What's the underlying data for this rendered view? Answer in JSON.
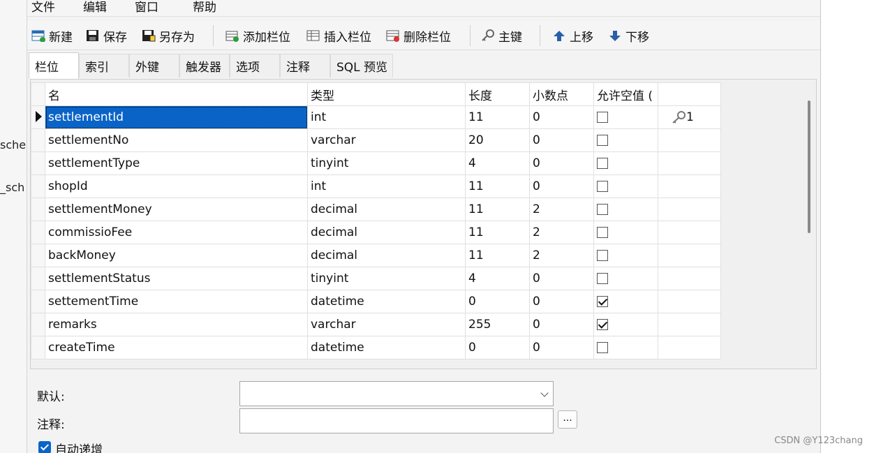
{
  "background_fragments": [
    "sche",
    "_sch"
  ],
  "menu": [
    "文件",
    "编辑",
    "窗口",
    "帮助"
  ],
  "toolbar": {
    "new": "新建",
    "save": "保存",
    "save_as": "另存为",
    "add_field": "添加栏位",
    "insert_field": "插入栏位",
    "delete_field": "删除栏位",
    "primary_key": "主键",
    "move_up": "上移",
    "move_down": "下移"
  },
  "tabs": [
    "栏位",
    "索引",
    "外键",
    "触发器",
    "选项",
    "注释",
    "SQL 预览"
  ],
  "active_tab": "栏位",
  "grid": {
    "headers": [
      "名",
      "类型",
      "长度",
      "小数点",
      "允许空值 (",
      ""
    ],
    "rows": [
      {
        "name": "settlementId",
        "type": "int",
        "length": "11",
        "decimals": "0",
        "nullable": false,
        "key": "1",
        "current": true
      },
      {
        "name": "settlementNo",
        "type": "varchar",
        "length": "20",
        "decimals": "0",
        "nullable": false,
        "key": ""
      },
      {
        "name": "settlementType",
        "type": "tinyint",
        "length": "4",
        "decimals": "0",
        "nullable": false,
        "key": ""
      },
      {
        "name": "shopId",
        "type": "int",
        "length": "11",
        "decimals": "0",
        "nullable": false,
        "key": ""
      },
      {
        "name": "settlementMoney",
        "type": "decimal",
        "length": "11",
        "decimals": "2",
        "nullable": false,
        "key": ""
      },
      {
        "name": "commissioFee",
        "type": "decimal",
        "length": "11",
        "decimals": "2",
        "nullable": false,
        "key": ""
      },
      {
        "name": "backMoney",
        "type": "decimal",
        "length": "11",
        "decimals": "2",
        "nullable": false,
        "key": ""
      },
      {
        "name": "settlementStatus",
        "type": "tinyint",
        "length": "4",
        "decimals": "0",
        "nullable": false,
        "key": ""
      },
      {
        "name": "settementTime",
        "type": "datetime",
        "length": "0",
        "decimals": "0",
        "nullable": true,
        "key": ""
      },
      {
        "name": "remarks",
        "type": "varchar",
        "length": "255",
        "decimals": "0",
        "nullable": true,
        "key": ""
      },
      {
        "name": "createTime",
        "type": "datetime",
        "length": "0",
        "decimals": "0",
        "nullable": false,
        "key": ""
      }
    ]
  },
  "properties": {
    "default_label": "默认:",
    "default_value": "",
    "comment_label": "注释:",
    "comment_value": "",
    "more_label": "...",
    "auto_increment_label": "自动递增",
    "auto_increment_checked": true
  },
  "watermark": "CSDN @Y123chang",
  "colors": {
    "selection": "#0a64c8",
    "window_bg": "#f3f3f3"
  }
}
